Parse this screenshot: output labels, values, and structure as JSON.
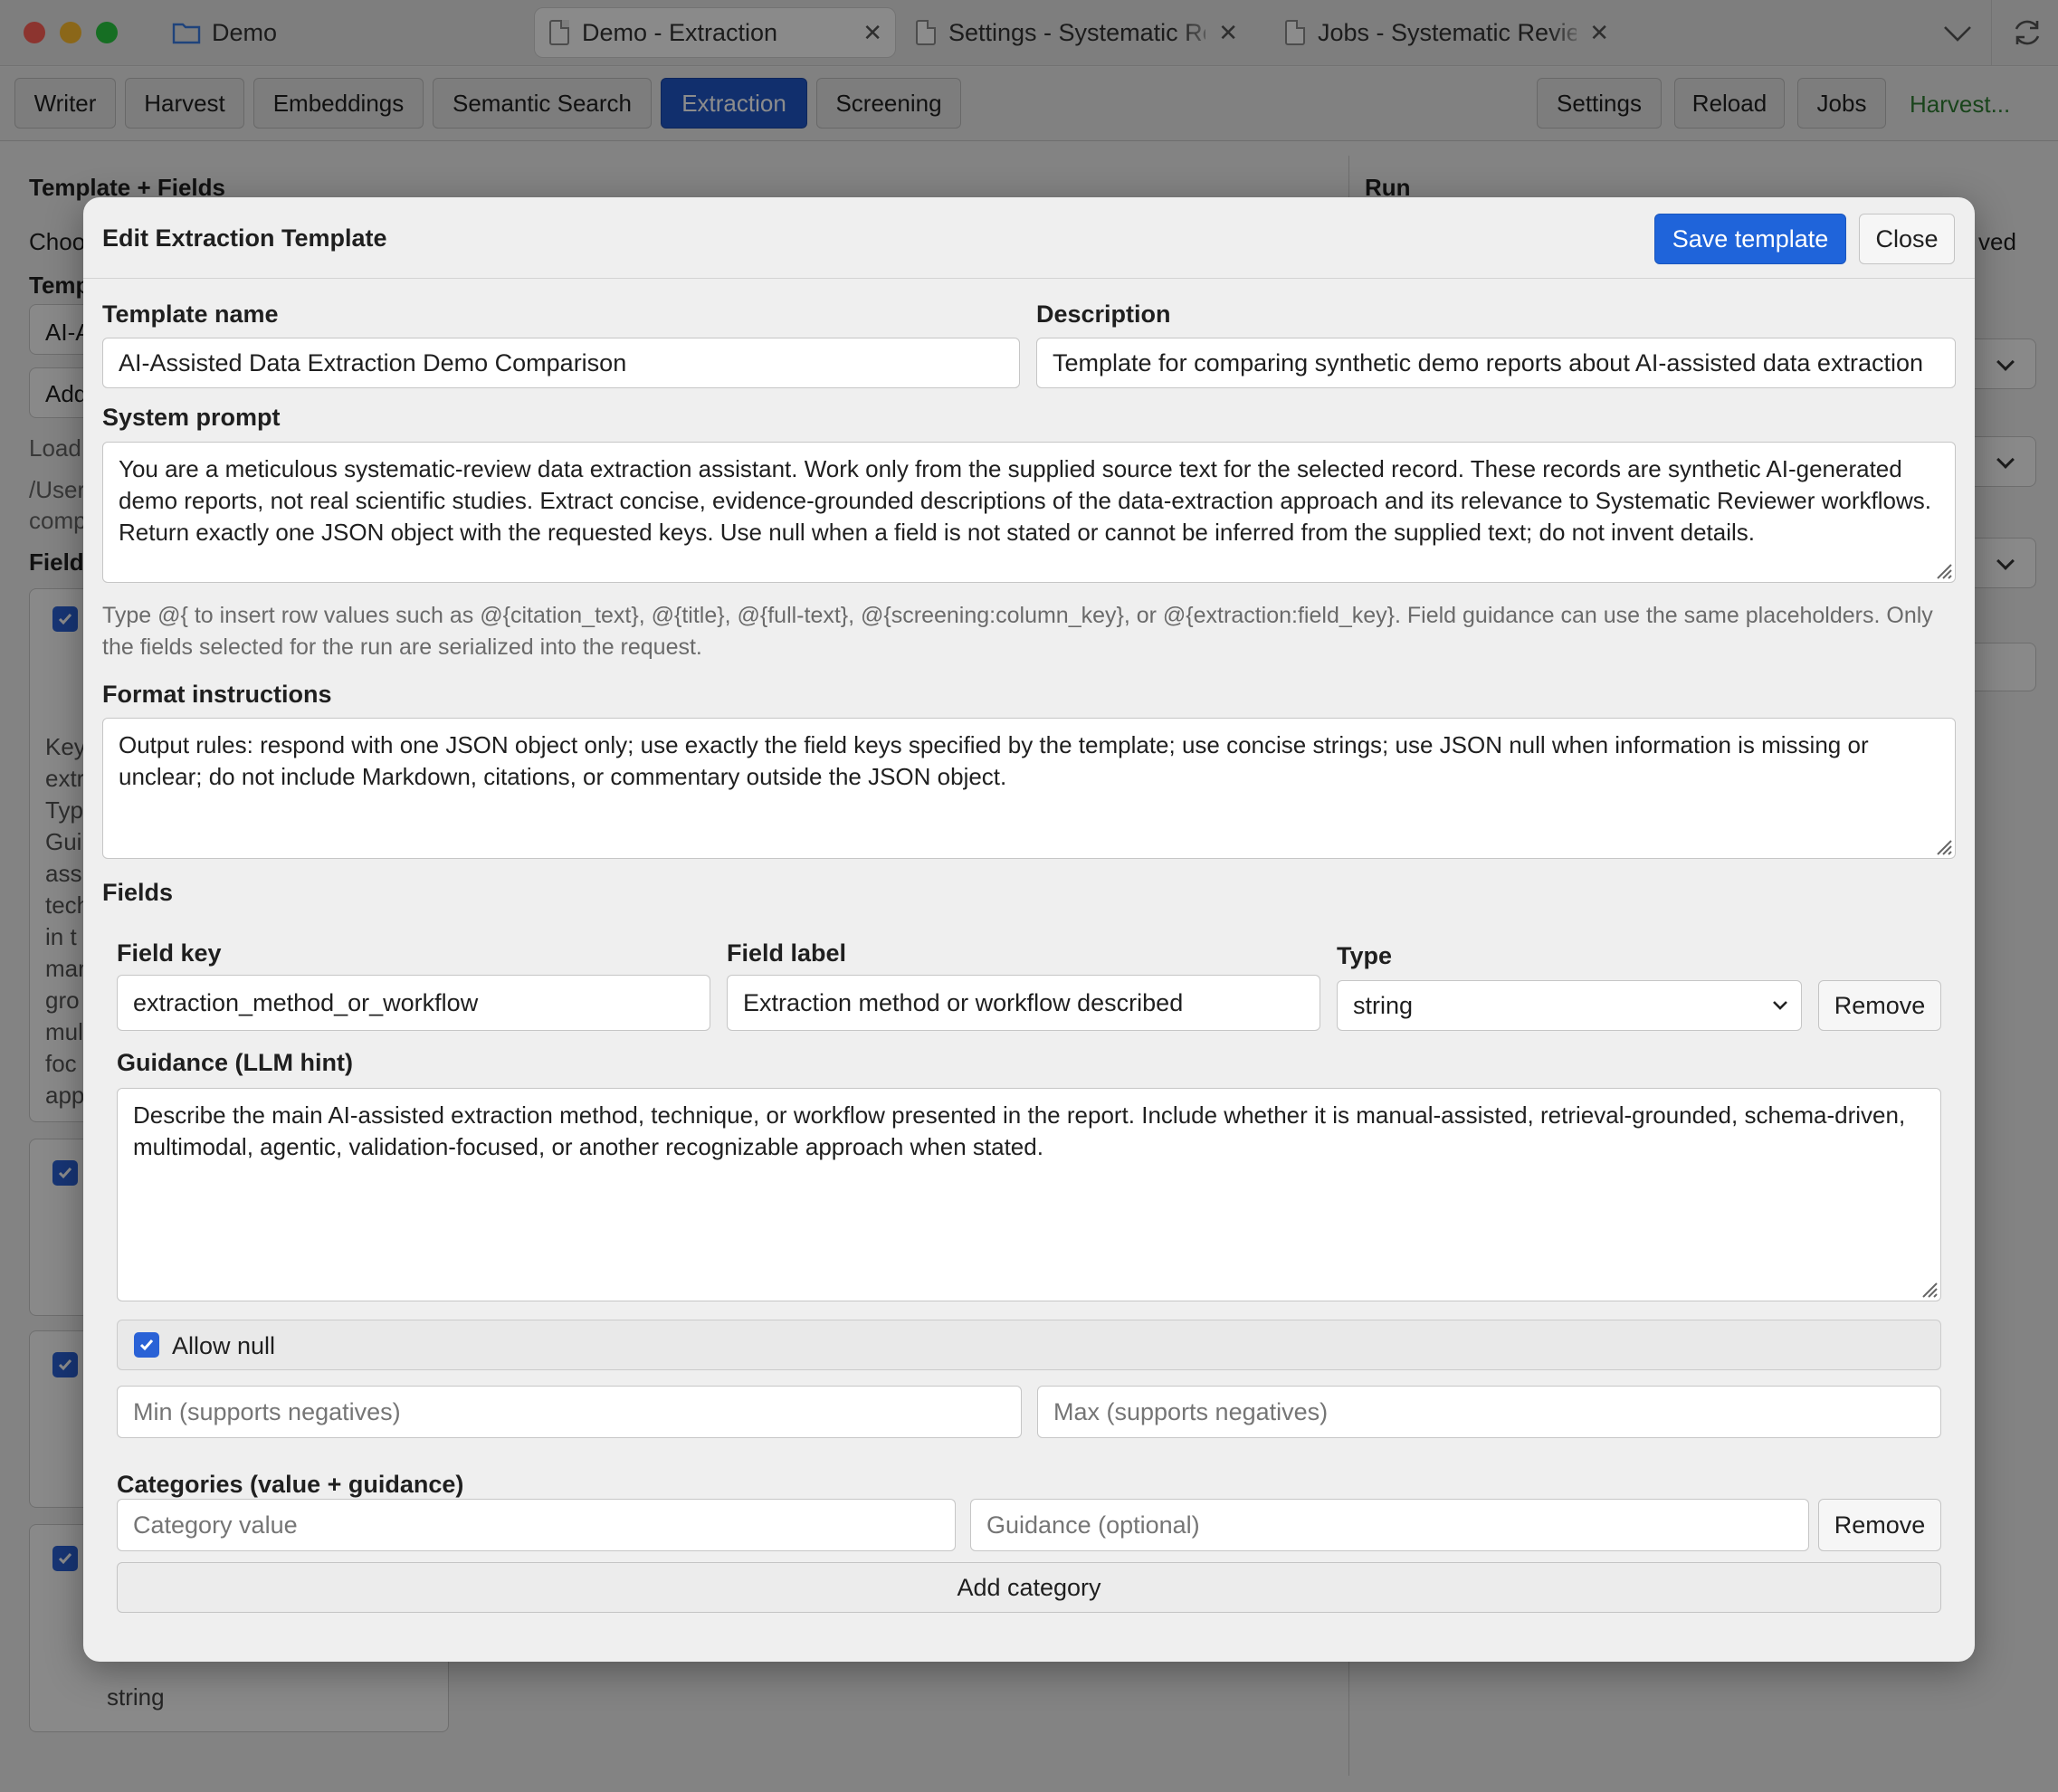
{
  "window": {
    "tabs": [
      {
        "label": "Demo"
      },
      {
        "label": "Demo - Extraction"
      },
      {
        "label": "Settings - Systematic Review"
      },
      {
        "label": "Jobs - Systematic Review"
      }
    ]
  },
  "toolbar": {
    "left": [
      "Writer",
      "Harvest",
      "Embeddings",
      "Semantic Search",
      "Extraction",
      "Screening"
    ],
    "active": "Extraction",
    "right": [
      "Settings",
      "Reload",
      "Jobs"
    ],
    "status": "Harvest...",
    "status_color": "#2e7d32"
  },
  "background": {
    "left_heading": "Template + Fields",
    "right_heading": "Run",
    "left_snippets": [
      "Choo",
      "Temp",
      "AI-A",
      "Add",
      "Load",
      "/User",
      "comp",
      "Field",
      "Key",
      "extr",
      "Typ",
      "Gui",
      "ass",
      "tech",
      "in t",
      "mar",
      "gro",
      "mul",
      "foc",
      "app",
      "string"
    ],
    "right_snippet": "ved"
  },
  "modal": {
    "title": "Edit Extraction Template",
    "save_label": "Save template",
    "close_label": "Close",
    "template_name_label": "Template name",
    "template_name_value": "AI-Assisted Data Extraction Demo Comparison",
    "description_label": "Description",
    "description_value": "Template for comparing synthetic demo reports about AI-assisted data extraction",
    "system_prompt_label": "System prompt",
    "system_prompt_value": "You are a meticulous systematic-review data extraction assistant. Work only from the supplied source text for the selected record. These records are synthetic AI-generated demo reports, not real scientific studies. Extract concise, evidence-grounded descriptions of the data-extraction approach and its relevance to Systematic Reviewer workflows. Return exactly one JSON object with the requested keys. Use null when a field is not stated or cannot be inferred from the supplied text; do not invent details.",
    "placeholder_hint": "Type @{ to insert row values such as @{citation_text}, @{title}, @{full-text}, @{screening:column_key}, or @{extraction:field_key}. Field guidance can use the same placeholders. Only the fields selected for the run are serialized into the request.",
    "format_label": "Format instructions",
    "format_value": "Output rules: respond with one JSON object only; use exactly the field keys specified by the template; use concise strings; use JSON null when information is missing or unclear; do not include Markdown, citations, or commentary outside the JSON object.",
    "fields_label": "Fields",
    "field": {
      "key_label": "Field key",
      "key_value": "extraction_method_or_workflow",
      "label_label": "Field label",
      "label_value": "Extraction method or workflow described",
      "type_label": "Type",
      "type_value": "string",
      "remove_label": "Remove",
      "guidance_label": "Guidance (LLM hint)",
      "guidance_value": "Describe the main AI-assisted extraction method, technique, or workflow presented in the report. Include whether it is manual-assisted, retrieval-grounded, schema-driven, multimodal, agentic, validation-focused, or another recognizable approach when stated.",
      "allow_null_label": "Allow null",
      "allow_null_checked": true,
      "min_placeholder": "Min (supports negatives)",
      "max_placeholder": "Max (supports negatives)",
      "categories_label": "Categories (value + guidance)",
      "category_value_placeholder": "Category value",
      "category_guidance_placeholder": "Guidance (optional)",
      "category_remove_label": "Remove",
      "add_category_label": "Add category"
    }
  },
  "colors": {
    "accent": "#1f64da",
    "active_tab": "#1f56c7"
  }
}
